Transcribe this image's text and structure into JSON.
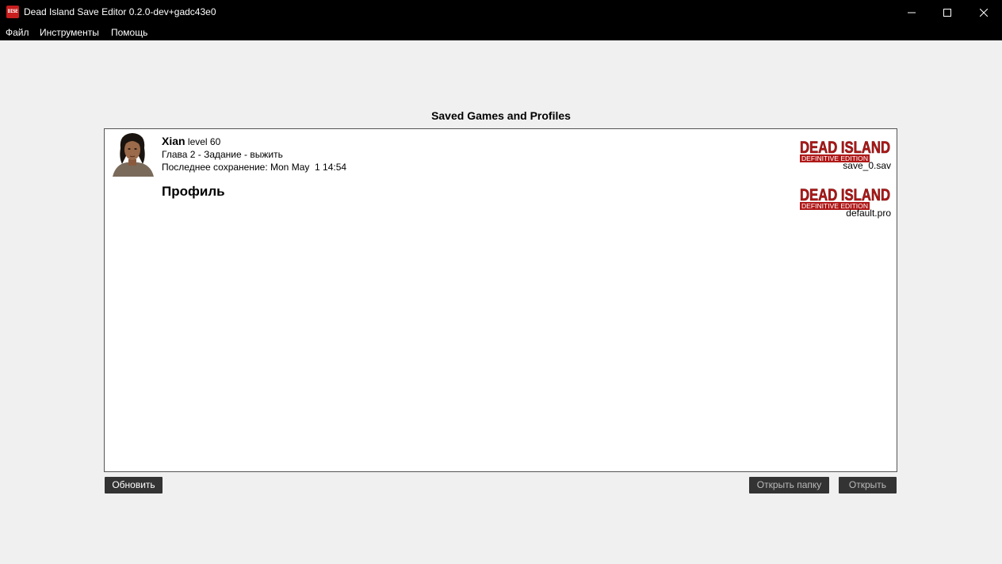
{
  "window": {
    "title": "Dead Island Save Editor 0.2.0-dev+gadc43e0",
    "icon": "app-icon",
    "icon_text": "DISE",
    "controls": [
      "minimize-icon",
      "maximize-icon",
      "close-icon"
    ]
  },
  "menu": {
    "items": [
      {
        "label": "Файл"
      },
      {
        "label": "Инструменты"
      },
      {
        "label": "Помощь"
      }
    ]
  },
  "main": {
    "heading": "Saved Games and Profiles",
    "saves": [
      {
        "name": "Xian",
        "level": "level 60",
        "chapter": "Глава 2 - Задание - выжить",
        "last_saved": "Последнее сохранение: Mon May  1 14:54",
        "filename": "save_0.sav",
        "logo_title": "DEAD ISLAND",
        "logo_subtitle": "DEFINITIVE EDITION"
      }
    ],
    "profile": {
      "title": "Профиль",
      "filename": "default.pro",
      "logo_title": "DEAD ISLAND",
      "logo_subtitle": "DEFINITIVE EDITION"
    }
  },
  "buttons": {
    "refresh": "Обновить",
    "open_folder": "Открыть папку",
    "open": "Открыть"
  },
  "colors": {
    "titlebar": "#000000",
    "logo_red": "#b01818",
    "button_bg": "#333333"
  }
}
